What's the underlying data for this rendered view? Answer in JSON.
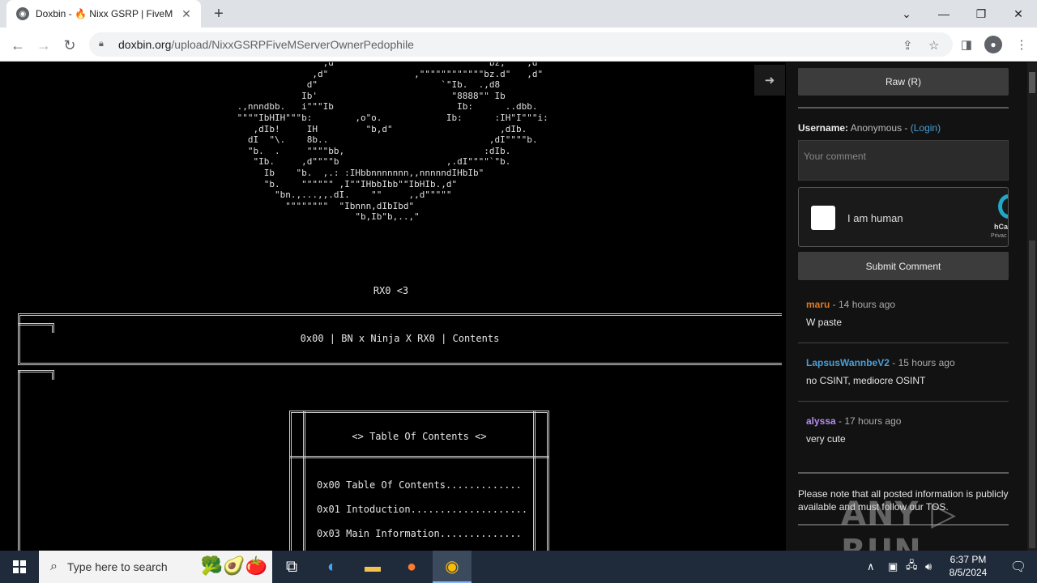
{
  "browser": {
    "tab_title": "Doxbin - 🔥 Nixx GSRP | FiveM S",
    "tab_close": "✕",
    "new_tab": "+",
    "url_host": "doxbin.org",
    "url_path": "/upload/NixxGSRPFiveMServerOwnerPedophile"
  },
  "paste": {
    "ascii_art": "                 ,d\"              \"\"\"\"\"\"\"\"\"\"\"\"\"\"bz,    ,d\"\n               ,d\"                ,\"\"\"\"\"\"\"\"\"\"\"\"bz.d\"   ,d\"\n              d\"                       `\"Ib.  .,d8\n             Ib'                         \"8888\"\" Ib\n .,nnndbb.   i\"\"\"Ib                       Ib:      ..dbb.\n \"\"\"\"IbHIH\"\"\"b:        ,o\"o.            Ib:      :IH\"I\"\"\"i:\n    ,dIb!     IH         \"b,d\"                    ,dIb.\n   dI  \"\\.    8b..                              ,dI\"\"\"\"b.\n   \"b.  .     \"\"\"\"bb,                          :dIb.\n    \"Ib.     ,d\"\"\"\"b                    ,.dI\"\"\"\"`\"b.\n      Ib    \"b.  ,.: :IHbbnnnnnnn,,nnnnndIHbIb\"\n      \"b.    \"\"\"\"\"\" ,I\"\"IHbbIbb\"\"IbHIb.,d\"\n        \"bn.,...,,.dI.    \"\"     ,,d\"\"\"\"\"\n          \"\"\"\"\"\"\"\"  \"Ibnnn,dIbIbd\"\n                       \"b,Ib\"b,..,\"",
    "signature": "RX0 <3",
    "header": "0x00 | BN x Ninja X RX0 | Contents",
    "toc_title": "<> Table Of Contents <>",
    "toc_items": [
      "0x00 Table Of Contents.............",
      "0x01 Intoduction....................",
      "0x03 Main Information.............."
    ]
  },
  "sidebar": {
    "raw_label": "Raw (R)",
    "username_label": "Username:",
    "username_value": "Anonymous",
    "username_sep": " - ",
    "login_label": "(Login)",
    "comment_placeholder": "Your comment",
    "captcha_label": "I am human",
    "captcha_brand": "hCa",
    "captcha_priv": "Privac",
    "submit_label": "Submit Comment",
    "comments": [
      {
        "user": "maru",
        "user_color": "#e07a1f",
        "time": " - 14 hours ago",
        "body": "W paste"
      },
      {
        "user": "LapsusWannbeV2",
        "user_color": "#4a9fd8",
        "time": " - 15 hours ago",
        "body": "no CSINT, mediocre OSINT"
      },
      {
        "user": "alyssa",
        "user_color": "#b38cf0",
        "time": " - 17 hours ago",
        "body": "very cute"
      }
    ],
    "notice": "Please note that all posted information is publicly available and must follow our TOS."
  },
  "watermark": "ANY ▷ RUN",
  "taskbar": {
    "search_placeholder": "Type here to search",
    "time": "6:37 PM",
    "date": "8/5/2024"
  }
}
